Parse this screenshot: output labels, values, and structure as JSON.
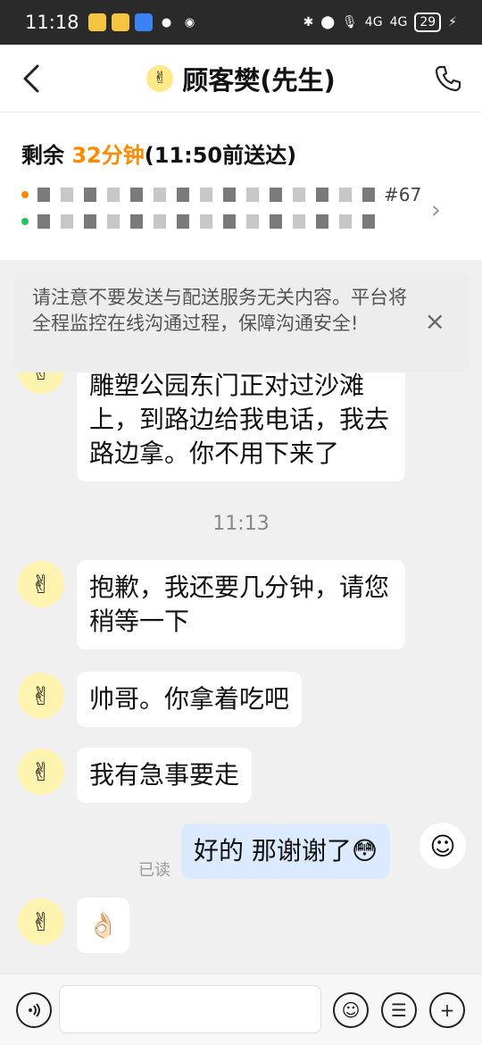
{
  "status_bar": {
    "time": "11:18",
    "battery": "29",
    "net1": "4G",
    "net2": "4G"
  },
  "header": {
    "title": "顾客樊(先生)"
  },
  "order": {
    "remain_prefix": "剩余 ",
    "remain_minutes": "32分钟",
    "remain_suffix": "(11:50前送达)",
    "order_no": "#67"
  },
  "notice": {
    "text": "请注意不要发送与配送服务无关内容。平台将全程监控在线沟通过程，保障沟通安全!",
    "close": "×"
  },
  "messages": [
    {
      "from": "customer",
      "text": "雕塑公园东门正对过沙滩上，到路边给我电话，我去路边拿。你不用下来了"
    },
    {
      "from": "customer",
      "text": "抱歉，我还要几分钟，请您稍等一下"
    },
    {
      "from": "customer",
      "text": "帅哥。你拿着吃吧"
    },
    {
      "from": "customer",
      "text": "我有急事要走"
    },
    {
      "from": "me",
      "text": "好的 那谢谢了😳",
      "read_label": "已读"
    },
    {
      "from": "customer",
      "text": "👌🏻"
    }
  ],
  "timestamp": "11:13",
  "colors": {
    "accent": "#ff8a00",
    "self_bubble": "#dbeafe",
    "background": "#f0f0f0"
  }
}
